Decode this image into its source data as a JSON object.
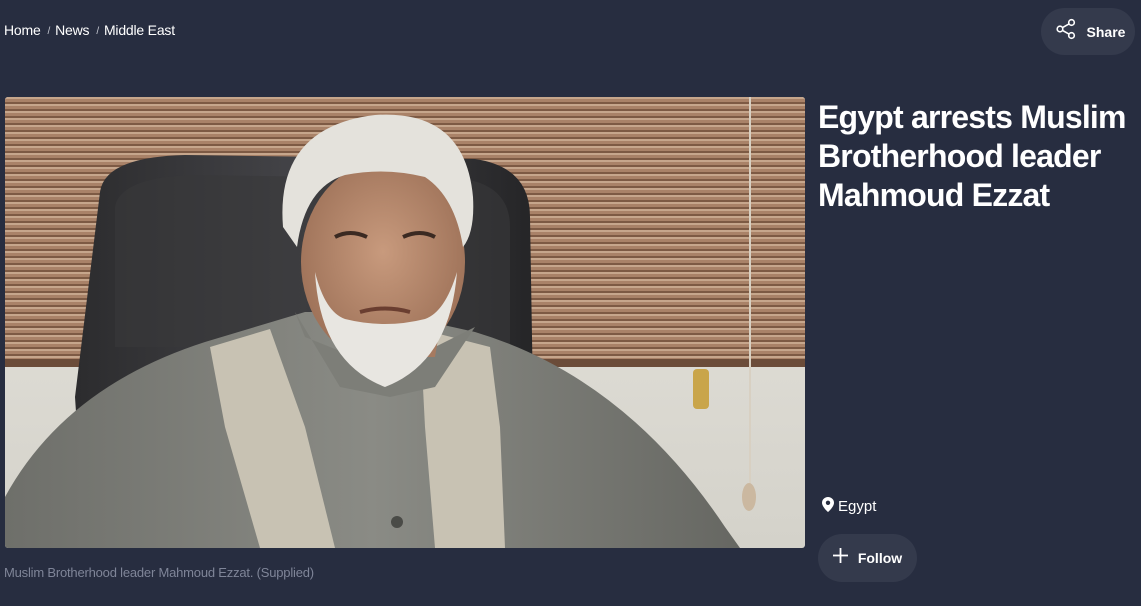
{
  "breadcrumb": {
    "items": [
      {
        "label": "Home"
      },
      {
        "label": "News"
      },
      {
        "label": "Middle East"
      }
    ],
    "separator": "/"
  },
  "share": {
    "label": "Share",
    "icon": "share-icon"
  },
  "article": {
    "headline": "Egypt arrests Muslim Brotherhood leader Mahmoud Ezzat",
    "image_caption": "Muslim Brotherhood leader Mahmoud Ezzat. (Supplied)",
    "location": {
      "label": "Egypt",
      "icon": "map-pin-icon"
    },
    "follow": {
      "label": "Follow",
      "icon": "plus-icon"
    }
  },
  "colors": {
    "background": "#272d40",
    "button_background": "#343a4c",
    "caption_text": "#7f8598",
    "text": "#ffffff"
  }
}
